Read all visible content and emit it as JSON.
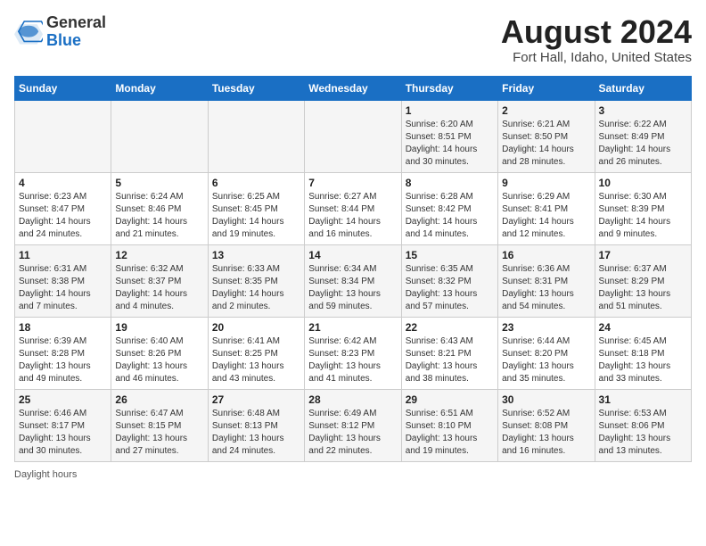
{
  "header": {
    "logo": {
      "general": "General",
      "blue": "Blue"
    },
    "title": "August 2024",
    "location": "Fort Hall, Idaho, United States"
  },
  "days_of_week": [
    "Sunday",
    "Monday",
    "Tuesday",
    "Wednesday",
    "Thursday",
    "Friday",
    "Saturday"
  ],
  "weeks": [
    [
      {
        "day": "",
        "info": ""
      },
      {
        "day": "",
        "info": ""
      },
      {
        "day": "",
        "info": ""
      },
      {
        "day": "",
        "info": ""
      },
      {
        "day": "1",
        "info": "Sunrise: 6:20 AM\nSunset: 8:51 PM\nDaylight: 14 hours and 30 minutes."
      },
      {
        "day": "2",
        "info": "Sunrise: 6:21 AM\nSunset: 8:50 PM\nDaylight: 14 hours and 28 minutes."
      },
      {
        "day": "3",
        "info": "Sunrise: 6:22 AM\nSunset: 8:49 PM\nDaylight: 14 hours and 26 minutes."
      }
    ],
    [
      {
        "day": "4",
        "info": "Sunrise: 6:23 AM\nSunset: 8:47 PM\nDaylight: 14 hours and 24 minutes."
      },
      {
        "day": "5",
        "info": "Sunrise: 6:24 AM\nSunset: 8:46 PM\nDaylight: 14 hours and 21 minutes."
      },
      {
        "day": "6",
        "info": "Sunrise: 6:25 AM\nSunset: 8:45 PM\nDaylight: 14 hours and 19 minutes."
      },
      {
        "day": "7",
        "info": "Sunrise: 6:27 AM\nSunset: 8:44 PM\nDaylight: 14 hours and 16 minutes."
      },
      {
        "day": "8",
        "info": "Sunrise: 6:28 AM\nSunset: 8:42 PM\nDaylight: 14 hours and 14 minutes."
      },
      {
        "day": "9",
        "info": "Sunrise: 6:29 AM\nSunset: 8:41 PM\nDaylight: 14 hours and 12 minutes."
      },
      {
        "day": "10",
        "info": "Sunrise: 6:30 AM\nSunset: 8:39 PM\nDaylight: 14 hours and 9 minutes."
      }
    ],
    [
      {
        "day": "11",
        "info": "Sunrise: 6:31 AM\nSunset: 8:38 PM\nDaylight: 14 hours and 7 minutes."
      },
      {
        "day": "12",
        "info": "Sunrise: 6:32 AM\nSunset: 8:37 PM\nDaylight: 14 hours and 4 minutes."
      },
      {
        "day": "13",
        "info": "Sunrise: 6:33 AM\nSunset: 8:35 PM\nDaylight: 14 hours and 2 minutes."
      },
      {
        "day": "14",
        "info": "Sunrise: 6:34 AM\nSunset: 8:34 PM\nDaylight: 13 hours and 59 minutes."
      },
      {
        "day": "15",
        "info": "Sunrise: 6:35 AM\nSunset: 8:32 PM\nDaylight: 13 hours and 57 minutes."
      },
      {
        "day": "16",
        "info": "Sunrise: 6:36 AM\nSunset: 8:31 PM\nDaylight: 13 hours and 54 minutes."
      },
      {
        "day": "17",
        "info": "Sunrise: 6:37 AM\nSunset: 8:29 PM\nDaylight: 13 hours and 51 minutes."
      }
    ],
    [
      {
        "day": "18",
        "info": "Sunrise: 6:39 AM\nSunset: 8:28 PM\nDaylight: 13 hours and 49 minutes."
      },
      {
        "day": "19",
        "info": "Sunrise: 6:40 AM\nSunset: 8:26 PM\nDaylight: 13 hours and 46 minutes."
      },
      {
        "day": "20",
        "info": "Sunrise: 6:41 AM\nSunset: 8:25 PM\nDaylight: 13 hours and 43 minutes."
      },
      {
        "day": "21",
        "info": "Sunrise: 6:42 AM\nSunset: 8:23 PM\nDaylight: 13 hours and 41 minutes."
      },
      {
        "day": "22",
        "info": "Sunrise: 6:43 AM\nSunset: 8:21 PM\nDaylight: 13 hours and 38 minutes."
      },
      {
        "day": "23",
        "info": "Sunrise: 6:44 AM\nSunset: 8:20 PM\nDaylight: 13 hours and 35 minutes."
      },
      {
        "day": "24",
        "info": "Sunrise: 6:45 AM\nSunset: 8:18 PM\nDaylight: 13 hours and 33 minutes."
      }
    ],
    [
      {
        "day": "25",
        "info": "Sunrise: 6:46 AM\nSunset: 8:17 PM\nDaylight: 13 hours and 30 minutes."
      },
      {
        "day": "26",
        "info": "Sunrise: 6:47 AM\nSunset: 8:15 PM\nDaylight: 13 hours and 27 minutes."
      },
      {
        "day": "27",
        "info": "Sunrise: 6:48 AM\nSunset: 8:13 PM\nDaylight: 13 hours and 24 minutes."
      },
      {
        "day": "28",
        "info": "Sunrise: 6:49 AM\nSunset: 8:12 PM\nDaylight: 13 hours and 22 minutes."
      },
      {
        "day": "29",
        "info": "Sunrise: 6:51 AM\nSunset: 8:10 PM\nDaylight: 13 hours and 19 minutes."
      },
      {
        "day": "30",
        "info": "Sunrise: 6:52 AM\nSunset: 8:08 PM\nDaylight: 13 hours and 16 minutes."
      },
      {
        "day": "31",
        "info": "Sunrise: 6:53 AM\nSunset: 8:06 PM\nDaylight: 13 hours and 13 minutes."
      }
    ]
  ],
  "footer": {
    "note": "Daylight hours"
  }
}
